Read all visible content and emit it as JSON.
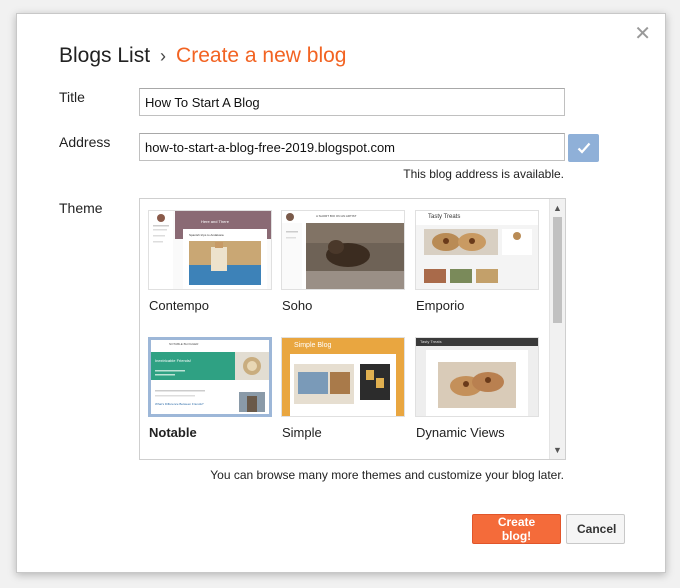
{
  "header": {
    "crumb": "Blogs List",
    "separator": "›",
    "current": "Create a new blog"
  },
  "form": {
    "title_label": "Title",
    "title_value": "How To Start A Blog",
    "address_label": "Address",
    "address_value": "how-to-start-a-blog-free-2019.blogspot.com",
    "availability": "This blog address is available.",
    "theme_label": "Theme"
  },
  "themes": [
    {
      "name": "Contempo",
      "selected": false
    },
    {
      "name": "Soho",
      "selected": false
    },
    {
      "name": "Emporio",
      "selected": false
    },
    {
      "name": "Notable",
      "selected": true
    },
    {
      "name": "Simple",
      "selected": false
    },
    {
      "name": "Dynamic Views",
      "selected": false
    }
  ],
  "thumb_text": {
    "contempo_hero": "Here and There",
    "contempo_post": "Spanish trips to Andalusia",
    "soho_header": "A SHORT BIO ON AN ARTIST",
    "emporio_brand": "Tasty Treats",
    "notable_brand": "NOTABLE BLOGGER",
    "notable_hero": "Inextricable Friends!",
    "notable_post": "What's Difference Between Friends?",
    "simple_title": "Simple Blog",
    "dynamic_brand": "Tasty Treats"
  },
  "browse_text": "You can browse many more themes and customize your blog later.",
  "buttons": {
    "create": "Create blog!",
    "cancel": "Cancel",
    "close_glyph": "✕"
  },
  "colors": {
    "accent": "#f26322",
    "create_button": "#f46b3a",
    "check_button": "#8fb0d8",
    "selected_border": "#9db7d8"
  }
}
